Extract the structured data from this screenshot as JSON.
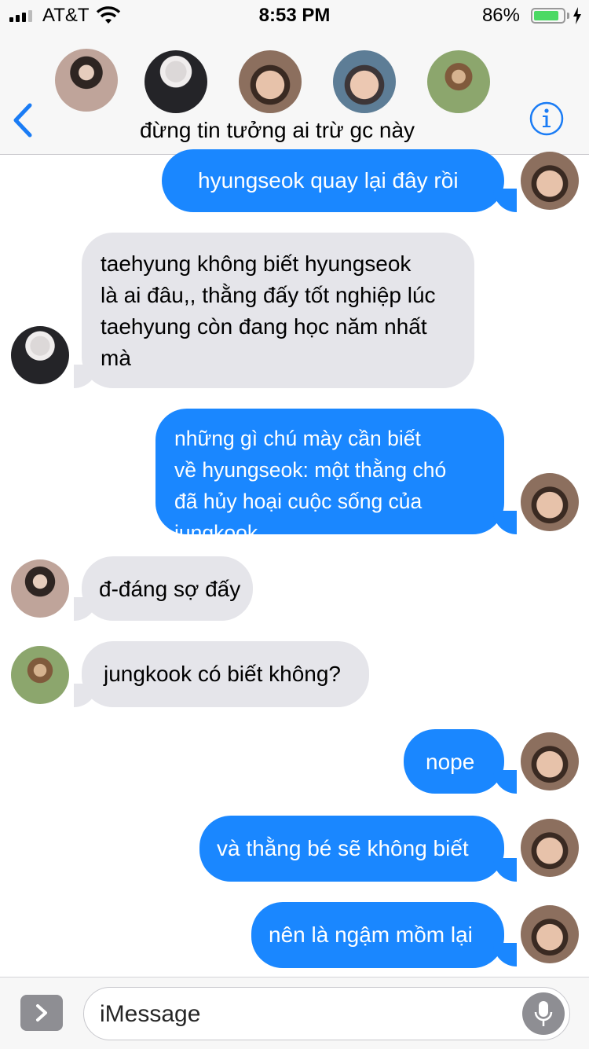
{
  "status_bar": {
    "carrier": "AT&T",
    "time": "8:53 PM",
    "battery_percent": "86%",
    "battery_level": 0.86
  },
  "header": {
    "group_name": "đừng tin tưởng ai trừ gc này",
    "participants": [
      {
        "avatar": "avatar-peace-sign"
      },
      {
        "avatar": "avatar-silver-hair"
      },
      {
        "avatar": "avatar-dark-hair"
      },
      {
        "avatar": "avatar-grey-hair"
      },
      {
        "avatar": "avatar-glasses"
      }
    ]
  },
  "messages": [
    {
      "direction": "outgoing",
      "lines": [
        "hyungseok quay lại đây rồi"
      ]
    },
    {
      "direction": "incoming",
      "lines": [
        "taehyung không biết hyungseok",
        "là ai đâu,, thằng đấy tốt nghiệp lúc",
        "taehyung còn đang học năm nhất",
        "mà"
      ]
    },
    {
      "direction": "outgoing",
      "lines": [
        "những gì chú mày cần biết",
        "về hyungseok: một thằng chó",
        "đã hủy hoại cuộc sống của jungkook"
      ]
    },
    {
      "direction": "incoming",
      "lines": [
        "đ-đáng sợ đấy"
      ]
    },
    {
      "direction": "incoming",
      "lines": [
        "jungkook có biết không?"
      ]
    },
    {
      "direction": "outgoing",
      "lines": [
        "nope"
      ]
    },
    {
      "direction": "outgoing",
      "lines": [
        "và thằng bé sẽ không biết"
      ]
    },
    {
      "direction": "outgoing",
      "lines": [
        "nên là ngậm mồm lại"
      ]
    }
  ],
  "composer": {
    "placeholder": "iMessage"
  },
  "colors": {
    "outgoing_bubble": "#1a87ff",
    "incoming_bubble": "#e5e5ea",
    "accent": "#1a7cf5",
    "battery": "#4cd964"
  },
  "icons": [
    "back-chevron-icon",
    "info-icon",
    "app-drawer-chevron-icon",
    "microphone-icon",
    "wifi-icon",
    "charging-bolt-icon"
  ]
}
